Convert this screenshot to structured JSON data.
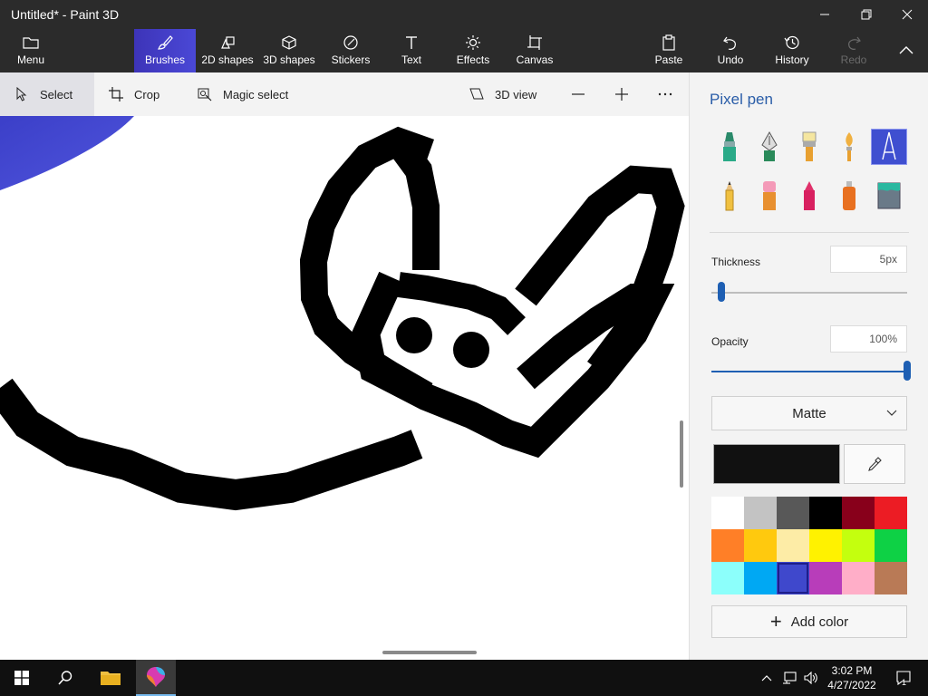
{
  "window": {
    "title": "Untitled* - Paint 3D"
  },
  "ribbon": {
    "menu": "Menu",
    "brushes": "Brushes",
    "shapes2d": "2D shapes",
    "shapes3d": "3D shapes",
    "stickers": "Stickers",
    "text": "Text",
    "effects": "Effects",
    "canvas": "Canvas",
    "paste": "Paste",
    "undo": "Undo",
    "history": "History",
    "redo": "Redo"
  },
  "subbar": {
    "select": "Select",
    "crop": "Crop",
    "magic_select": "Magic select",
    "view3d": "3D view"
  },
  "panel": {
    "title": "Pixel pen",
    "brushes": [
      "marker-icon",
      "calligraphy-pen-icon",
      "oil-brush-icon",
      "watercolor-icon",
      "pixel-pen-icon",
      "pencil-icon",
      "eraser-icon",
      "crayon-icon",
      "spray-can-icon",
      "fill-icon"
    ],
    "active_brush": "pixel-pen-icon",
    "thickness_label": "Thickness",
    "thickness_value": "5px",
    "thickness_fraction": 0.05,
    "opacity_label": "Opacity",
    "opacity_value": "100%",
    "opacity_fraction": 1.0,
    "finish": "Matte",
    "current_color": "#111111",
    "add_color": "Add color",
    "palette": [
      "#ffffff",
      "#c3c3c3",
      "#585858",
      "#000000",
      "#88001b",
      "#ec1c24",
      "#ff7f27",
      "#ffc90e",
      "#fdeca6",
      "#fff200",
      "#c4ff0e",
      "#0ed145",
      "#8cfffb",
      "#00a8f3",
      "#3f48cc",
      "#b83dba",
      "#ffaec8",
      "#b97a56"
    ],
    "selected_swatch": 14
  },
  "taskbar": {
    "time": "3:02 PM",
    "date": "4/27/2022",
    "notifications": "1"
  }
}
